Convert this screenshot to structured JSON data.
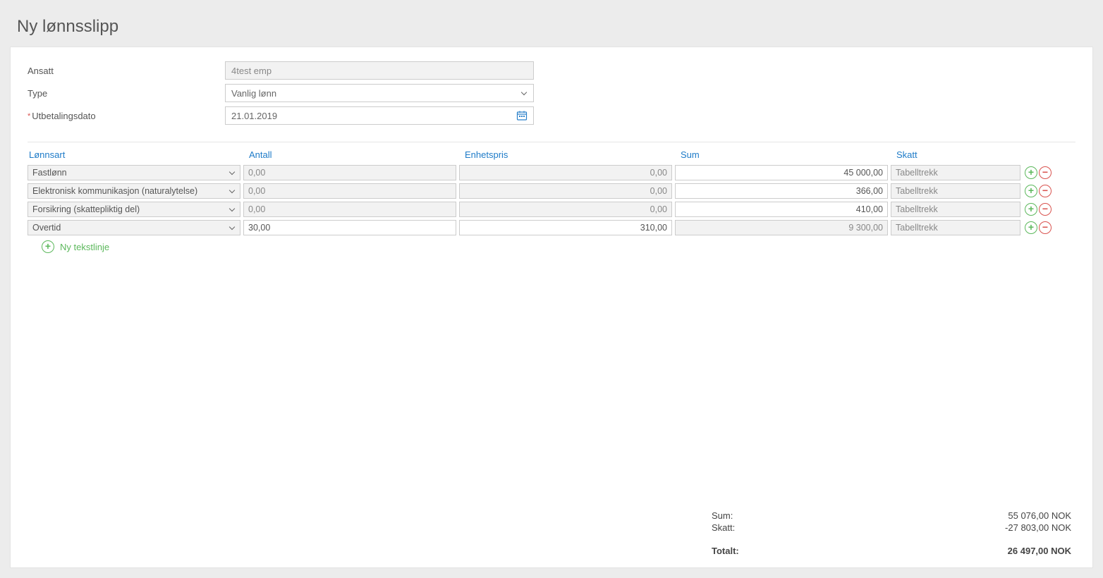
{
  "page": {
    "title": "Ny lønnsslipp"
  },
  "form": {
    "ansatt_label": "Ansatt",
    "ansatt_value": "4test emp",
    "type_label": "Type",
    "type_value": "Vanlig lønn",
    "date_label": "Utbetalingsdato",
    "date_value": "21.01.2019"
  },
  "grid": {
    "headers": {
      "lonnsart": "Lønnsart",
      "antall": "Antall",
      "enhetspris": "Enhetspris",
      "sum": "Sum",
      "skatt": "Skatt"
    },
    "rows": [
      {
        "lonnsart": "Fastlønn",
        "antall": "0,00",
        "enhetspris": "0,00",
        "sum": "45 000,00",
        "skatt": "Tabelltrekk",
        "antall_ro": true,
        "enhet_ro": true,
        "sum_ro": false
      },
      {
        "lonnsart": "Elektronisk kommunikasjon (naturalytelse)",
        "antall": "0,00",
        "enhetspris": "0,00",
        "sum": "366,00",
        "skatt": "Tabelltrekk",
        "antall_ro": true,
        "enhet_ro": true,
        "sum_ro": false
      },
      {
        "lonnsart": "Forsikring (skattepliktig del)",
        "antall": "0,00",
        "enhetspris": "0,00",
        "sum": "410,00",
        "skatt": "Tabelltrekk",
        "antall_ro": true,
        "enhet_ro": true,
        "sum_ro": false
      },
      {
        "lonnsart": "Overtid",
        "antall": "30,00",
        "enhetspris": "310,00",
        "sum": "9 300,00",
        "skatt": "Tabelltrekk",
        "antall_ro": false,
        "enhet_ro": false,
        "sum_ro": true
      }
    ],
    "add_line_label": "Ny tekstlinje"
  },
  "totals": {
    "sum_label": "Sum:",
    "sum_value": "55 076,00 NOK",
    "skatt_label": "Skatt:",
    "skatt_value": "-27 803,00 NOK",
    "total_label": "Totalt:",
    "total_value": "26 497,00 NOK"
  }
}
